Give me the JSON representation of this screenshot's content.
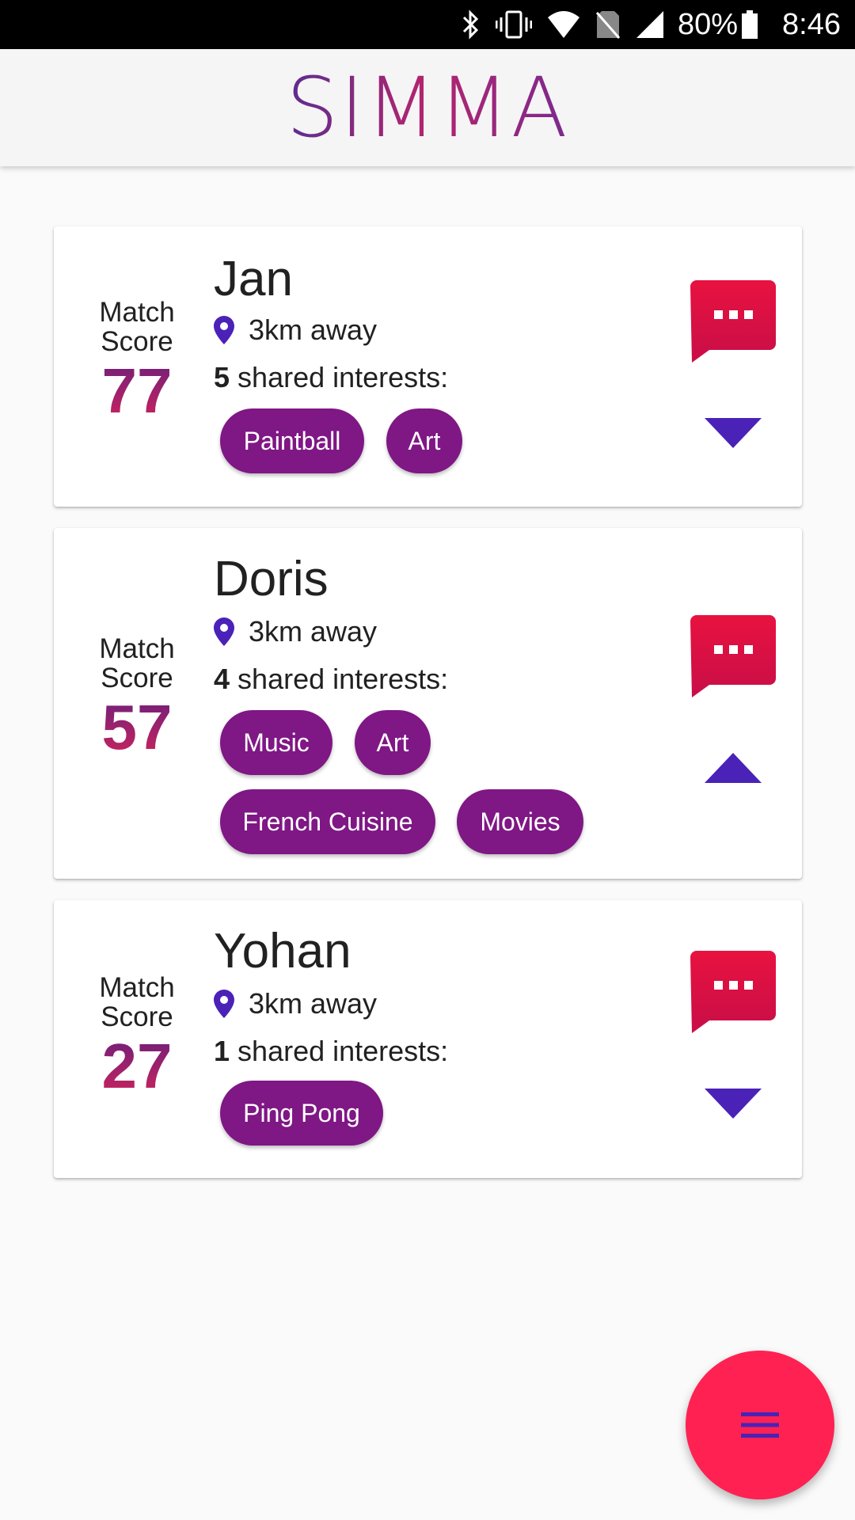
{
  "status_bar": {
    "battery": "80%",
    "time": "8:46",
    "icons": [
      "bluetooth-icon",
      "vibrate-icon",
      "wifi-icon",
      "no-sim-icon",
      "signal-icon",
      "battery-icon"
    ]
  },
  "app": {
    "logo_text": "SIMMA",
    "colors": {
      "accent": "#ff2152",
      "chip": "#7f1785",
      "icon": "#4a22b8",
      "chat": "#e8123f"
    }
  },
  "matches": [
    {
      "score_label": "Match Score",
      "score": "77",
      "name": "Jan",
      "distance": "3km away",
      "shared_count": "5",
      "shared_label": "shared interests:",
      "interests": [
        "Paintball",
        "Art"
      ],
      "expanded": false
    },
    {
      "score_label": "Match Score",
      "score": "57",
      "name": "Doris",
      "distance": "3km away",
      "shared_count": "4",
      "shared_label": "shared interests:",
      "interests": [
        "Music",
        "Art",
        "French Cuisine",
        "Movies"
      ],
      "expanded": true
    },
    {
      "score_label": "Match Score",
      "score": "27",
      "name": "Yohan",
      "distance": "3km away",
      "shared_count": "1",
      "shared_label": "shared interests:",
      "interests": [
        "Ping Pong"
      ],
      "expanded": false
    }
  ],
  "fab": {
    "icon": "menu-icon"
  }
}
